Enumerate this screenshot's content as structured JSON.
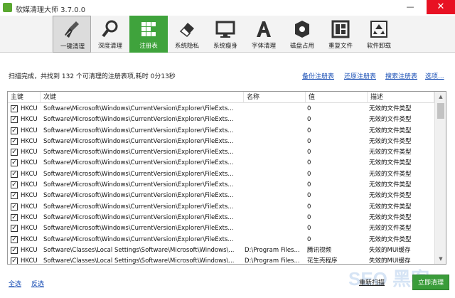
{
  "window": {
    "title": "软媒清理大师 3.7.0.0",
    "min": "—",
    "close": "✕"
  },
  "toolbar": {
    "items": [
      {
        "label": "一键清理",
        "icon": "broom-icon"
      },
      {
        "label": "深度清理",
        "icon": "magnifier-icon"
      },
      {
        "label": "注册表",
        "icon": "registry-grid-icon"
      },
      {
        "label": "系统隐私",
        "icon": "eraser-icon"
      },
      {
        "label": "系统瘦身",
        "icon": "monitor-icon"
      },
      {
        "label": "字体清理",
        "icon": "font-a-icon"
      },
      {
        "label": "磁盘占用",
        "icon": "disk-icon"
      },
      {
        "label": "重复文件",
        "icon": "duplicate-files-icon"
      },
      {
        "label": "软件卸载",
        "icon": "recycle-icon"
      }
    ],
    "active_index": 2
  },
  "status_text": "扫描完成，共找到 132 个可清理的注册表项,耗时 0分13秒",
  "links": {
    "backup": "备份注册表",
    "restore": "还原注册表",
    "search": "搜索注册表",
    "options": "选项..."
  },
  "table": {
    "columns": [
      "主键",
      "次键",
      "名称",
      "值",
      "描述"
    ],
    "rows": [
      {
        "checked": true,
        "key": "HKCU",
        "subkey": "Software\\Microsoft\\Windows\\CurrentVersion\\Explorer\\FileExts...",
        "name": "",
        "value": "0",
        "desc": "无效的文件类型"
      },
      {
        "checked": true,
        "key": "HKCU",
        "subkey": "Software\\Microsoft\\Windows\\CurrentVersion\\Explorer\\FileExts...",
        "name": "",
        "value": "0",
        "desc": "无效的文件类型"
      },
      {
        "checked": true,
        "key": "HKCU",
        "subkey": "Software\\Microsoft\\Windows\\CurrentVersion\\Explorer\\FileExts...",
        "name": "",
        "value": "0",
        "desc": "无效的文件类型"
      },
      {
        "checked": true,
        "key": "HKCU",
        "subkey": "Software\\Microsoft\\Windows\\CurrentVersion\\Explorer\\FileExts...",
        "name": "",
        "value": "0",
        "desc": "无效的文件类型"
      },
      {
        "checked": true,
        "key": "HKCU",
        "subkey": "Software\\Microsoft\\Windows\\CurrentVersion\\Explorer\\FileExts...",
        "name": "",
        "value": "0",
        "desc": "无效的文件类型"
      },
      {
        "checked": true,
        "key": "HKCU",
        "subkey": "Software\\Microsoft\\Windows\\CurrentVersion\\Explorer\\FileExts...",
        "name": "",
        "value": "0",
        "desc": "无效的文件类型"
      },
      {
        "checked": true,
        "key": "HKCU",
        "subkey": "Software\\Microsoft\\Windows\\CurrentVersion\\Explorer\\FileExts...",
        "name": "",
        "value": "0",
        "desc": "无效的文件类型"
      },
      {
        "checked": true,
        "key": "HKCU",
        "subkey": "Software\\Microsoft\\Windows\\CurrentVersion\\Explorer\\FileExts...",
        "name": "",
        "value": "0",
        "desc": "无效的文件类型"
      },
      {
        "checked": true,
        "key": "HKCU",
        "subkey": "Software\\Microsoft\\Windows\\CurrentVersion\\Explorer\\FileExts...",
        "name": "",
        "value": "0",
        "desc": "无效的文件类型"
      },
      {
        "checked": true,
        "key": "HKCU",
        "subkey": "Software\\Microsoft\\Windows\\CurrentVersion\\Explorer\\FileExts...",
        "name": "",
        "value": "0",
        "desc": "无效的文件类型"
      },
      {
        "checked": true,
        "key": "HKCU",
        "subkey": "Software\\Microsoft\\Windows\\CurrentVersion\\Explorer\\FileExts...",
        "name": "",
        "value": "0",
        "desc": "无效的文件类型"
      },
      {
        "checked": true,
        "key": "HKCU",
        "subkey": "Software\\Microsoft\\Windows\\CurrentVersion\\Explorer\\FileExts...",
        "name": "",
        "value": "0",
        "desc": "无效的文件类型"
      },
      {
        "checked": true,
        "key": "HKCU",
        "subkey": "Software\\Microsoft\\Windows\\CurrentVersion\\Explorer\\FileExts...",
        "name": "",
        "value": "0",
        "desc": "无效的文件类型"
      },
      {
        "checked": true,
        "key": "HKCU",
        "subkey": "Software\\Classes\\Local Settings\\Software\\Microsoft\\Windows\\...",
        "name": "D:\\Program Files...",
        "value": "腾讯视频",
        "desc": "失效的MUI缓存"
      },
      {
        "checked": true,
        "key": "HKCU",
        "subkey": "Software\\Classes\\Local Settings\\Software\\Microsoft\\Windows\\...",
        "name": "D:\\Program Files...",
        "value": "花生壳程序",
        "desc": "失效的MUI缓存"
      }
    ]
  },
  "bottom": {
    "select_all": "全选",
    "invert": "反选",
    "rescan": "重新扫描",
    "clean_now": "立即清理"
  },
  "watermark": "SEO 黑客"
}
